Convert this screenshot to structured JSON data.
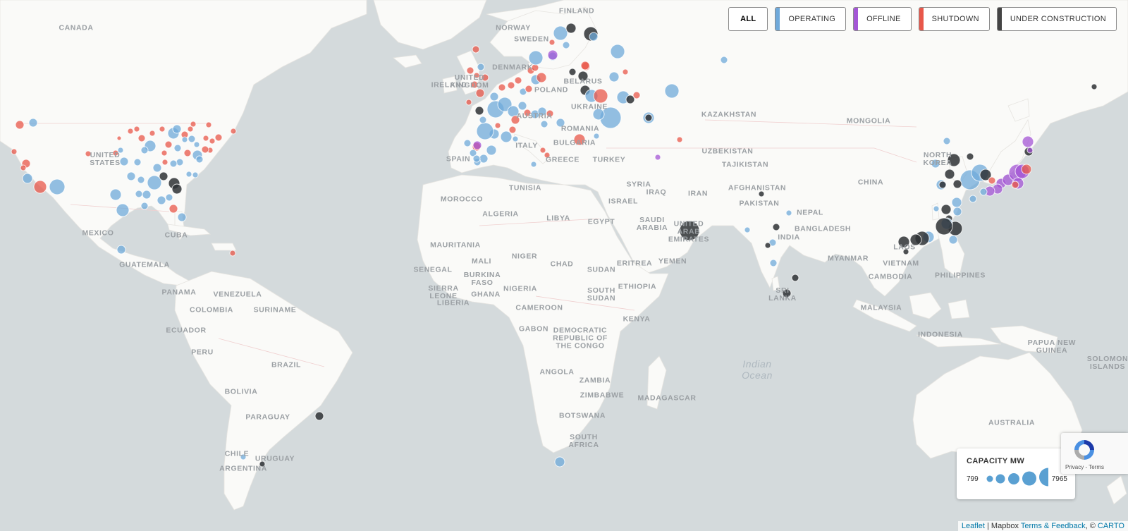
{
  "filters": [
    {
      "label": "ALL",
      "color": "",
      "active": true
    },
    {
      "label": "OPERATING",
      "color": "#6fa9da",
      "active": false
    },
    {
      "label": "OFFLINE",
      "color": "#a456d6",
      "active": false
    },
    {
      "label": "SHUTDOWN",
      "color": "#e8574a",
      "active": false
    },
    {
      "label": "UNDER CONSTRUCTION",
      "color": "#444444",
      "active": false
    }
  ],
  "legend": {
    "title": "CAPACITY MW",
    "min": "799",
    "max": "7965",
    "color": "#5aa0d2"
  },
  "recaptcha": {
    "privacy": "Privacy",
    "sep": " - ",
    "terms": "Terms"
  },
  "attribution": {
    "leaflet": "Leaflet",
    "sep1": " | Mapbox ",
    "terms_feedback": "Terms & Feedback",
    "sep2": ", © ",
    "carto": "CARTO"
  },
  "status_colors": {
    "operating": "#6fa9da",
    "offline": "#a456d6",
    "shutdown": "#e8574a",
    "construction": "#2e3135"
  },
  "country_labels": [
    "CANADA",
    "NORWAY",
    "SWEDEN",
    "FINLAND",
    "DENMARK",
    "UNITED\nKINGDOM",
    "IRELAND",
    "BELARUS",
    "POLAND",
    "UKRAINE",
    "AUSTRIA",
    "ROMANIA",
    "BULGARIA",
    "ITALY",
    "SPAIN",
    "GREECE",
    "TURKEY",
    "KAZAKHSTAN",
    "MONGOLIA",
    "UZBEKISTAN",
    "TAJIKISTAN",
    "NORTH\nKOREA",
    "CHINA",
    "UNITED\nSTATES",
    "MEXICO",
    "CUBA",
    "GUATEMALA",
    "PANAMA",
    "VENEZUELA",
    "COLOMBIA",
    "SURINAME",
    "ECUADOR",
    "PERU",
    "BRAZIL",
    "BOLIVIA",
    "PARAGUAY",
    "CHILE",
    "URUGUAY",
    "ARGENTINA",
    "MOROCCO",
    "TUNISIA",
    "ALGERIA",
    "LIBYA",
    "EGYPT",
    "SYRIA",
    "ISRAEL",
    "IRAQ",
    "IRAN",
    "AFGHANISTAN",
    "PAKISTAN",
    "NEPAL",
    "BANGLADESH",
    "INDIA",
    "SAUDI\nARABIA",
    "UNITED\nARAB\nEMIRATES",
    "YEMEN",
    "MYANMAR",
    "LAOS",
    "VIETNAM",
    "CAMBODIA",
    "PHILIPPINES",
    "MALAYSIA",
    "INDONESIA",
    "PAPUA NEW\nGUINEA",
    "SOLOMON\nISLANDS",
    "AUSTRALIA",
    "SRI\nLANKA",
    "MAURITANIA",
    "MALI",
    "NIGER",
    "CHAD",
    "SUDAN",
    "ERITREA",
    "SENEGAL",
    "BURKINA\nFASO",
    "SIERRA\nLEONE",
    "LIBERIA",
    "GHANA",
    "NIGERIA",
    "SOUTH\nSUDAN",
    "ETHIOPIA",
    "CAMEROON",
    "GABON",
    "DEMOCRATIC\nREPUBLIC OF\nTHE CONGO",
    "KENYA",
    "ANGOLA",
    "ZAMBIA",
    "ZIMBABWE",
    "MADAGASCAR",
    "BOTSWANA",
    "SOUTH\nAFRICA"
  ],
  "ocean_labels": [
    "Indian\nOcean"
  ]
}
